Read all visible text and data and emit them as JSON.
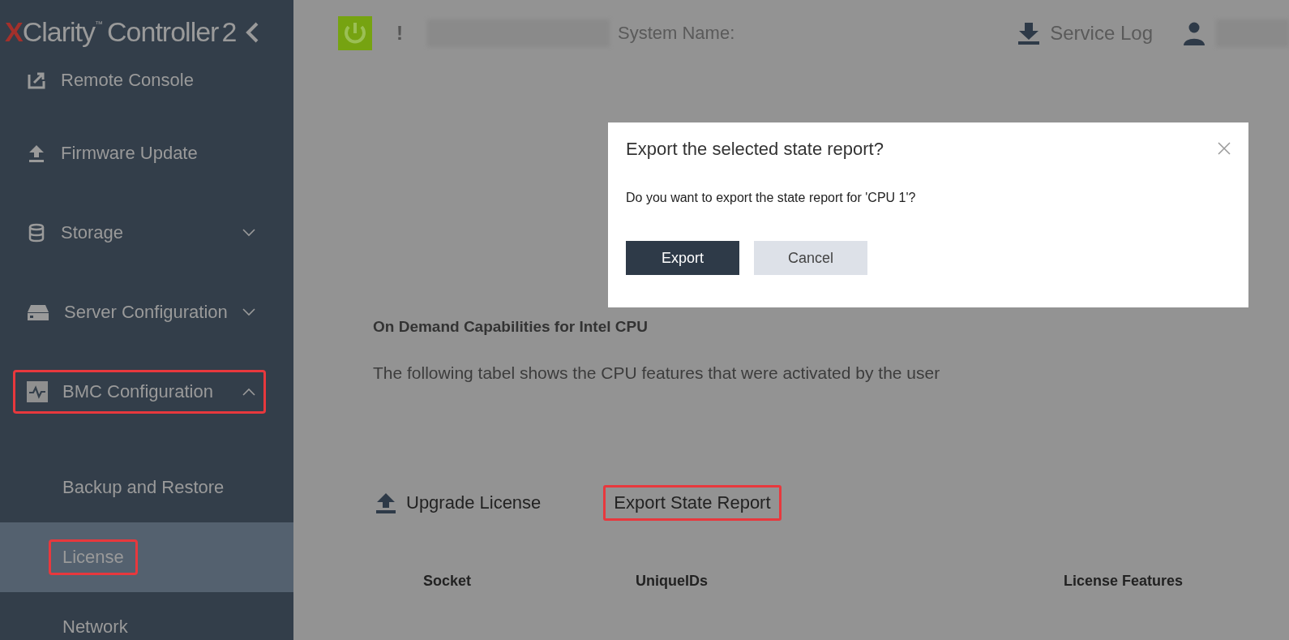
{
  "logo": {
    "mark": "X",
    "name": "Clarity",
    "tm": "™",
    "product": "Controller",
    "version": "2"
  },
  "sidebar": {
    "items": [
      {
        "label": "Remote Console",
        "kind": "link",
        "highlighted": false
      },
      {
        "label": "Firmware Update",
        "kind": "link",
        "highlighted": false
      },
      {
        "label": "Storage",
        "kind": "group",
        "expanded": false,
        "highlighted": false
      },
      {
        "label": "Server Configuration",
        "kind": "group",
        "expanded": false,
        "highlighted": false
      },
      {
        "label": "BMC Configuration",
        "kind": "group",
        "expanded": true,
        "highlighted": true,
        "children": [
          {
            "label": "Backup and Restore",
            "selected": false,
            "highlighted": false
          },
          {
            "label": "License",
            "selected": true,
            "highlighted": true
          },
          {
            "label": "Network",
            "selected": false,
            "highlighted": false
          }
        ]
      }
    ]
  },
  "header": {
    "alert": "!",
    "system_name_label": "System Name:",
    "service_log": "Service Log"
  },
  "page": {
    "heading": "On Demand Capabilities for Intel CPU",
    "description": "The following tabel shows the CPU features that were activated by the user",
    "actions": [
      {
        "label": "Upgrade License",
        "kind": "upload",
        "highlighted": false
      },
      {
        "label": "Export State Report",
        "kind": "plain",
        "highlighted": true
      }
    ],
    "table": {
      "columns": [
        "Socket",
        "UniqueIDs",
        "License Features"
      ]
    }
  },
  "dialog": {
    "title": "Export the selected state report?",
    "message": "Do you want to export the state report for 'CPU 1'?",
    "buttons": [
      {
        "label": "Export",
        "kind": "primary"
      },
      {
        "label": "Cancel",
        "kind": "secondary"
      }
    ]
  }
}
